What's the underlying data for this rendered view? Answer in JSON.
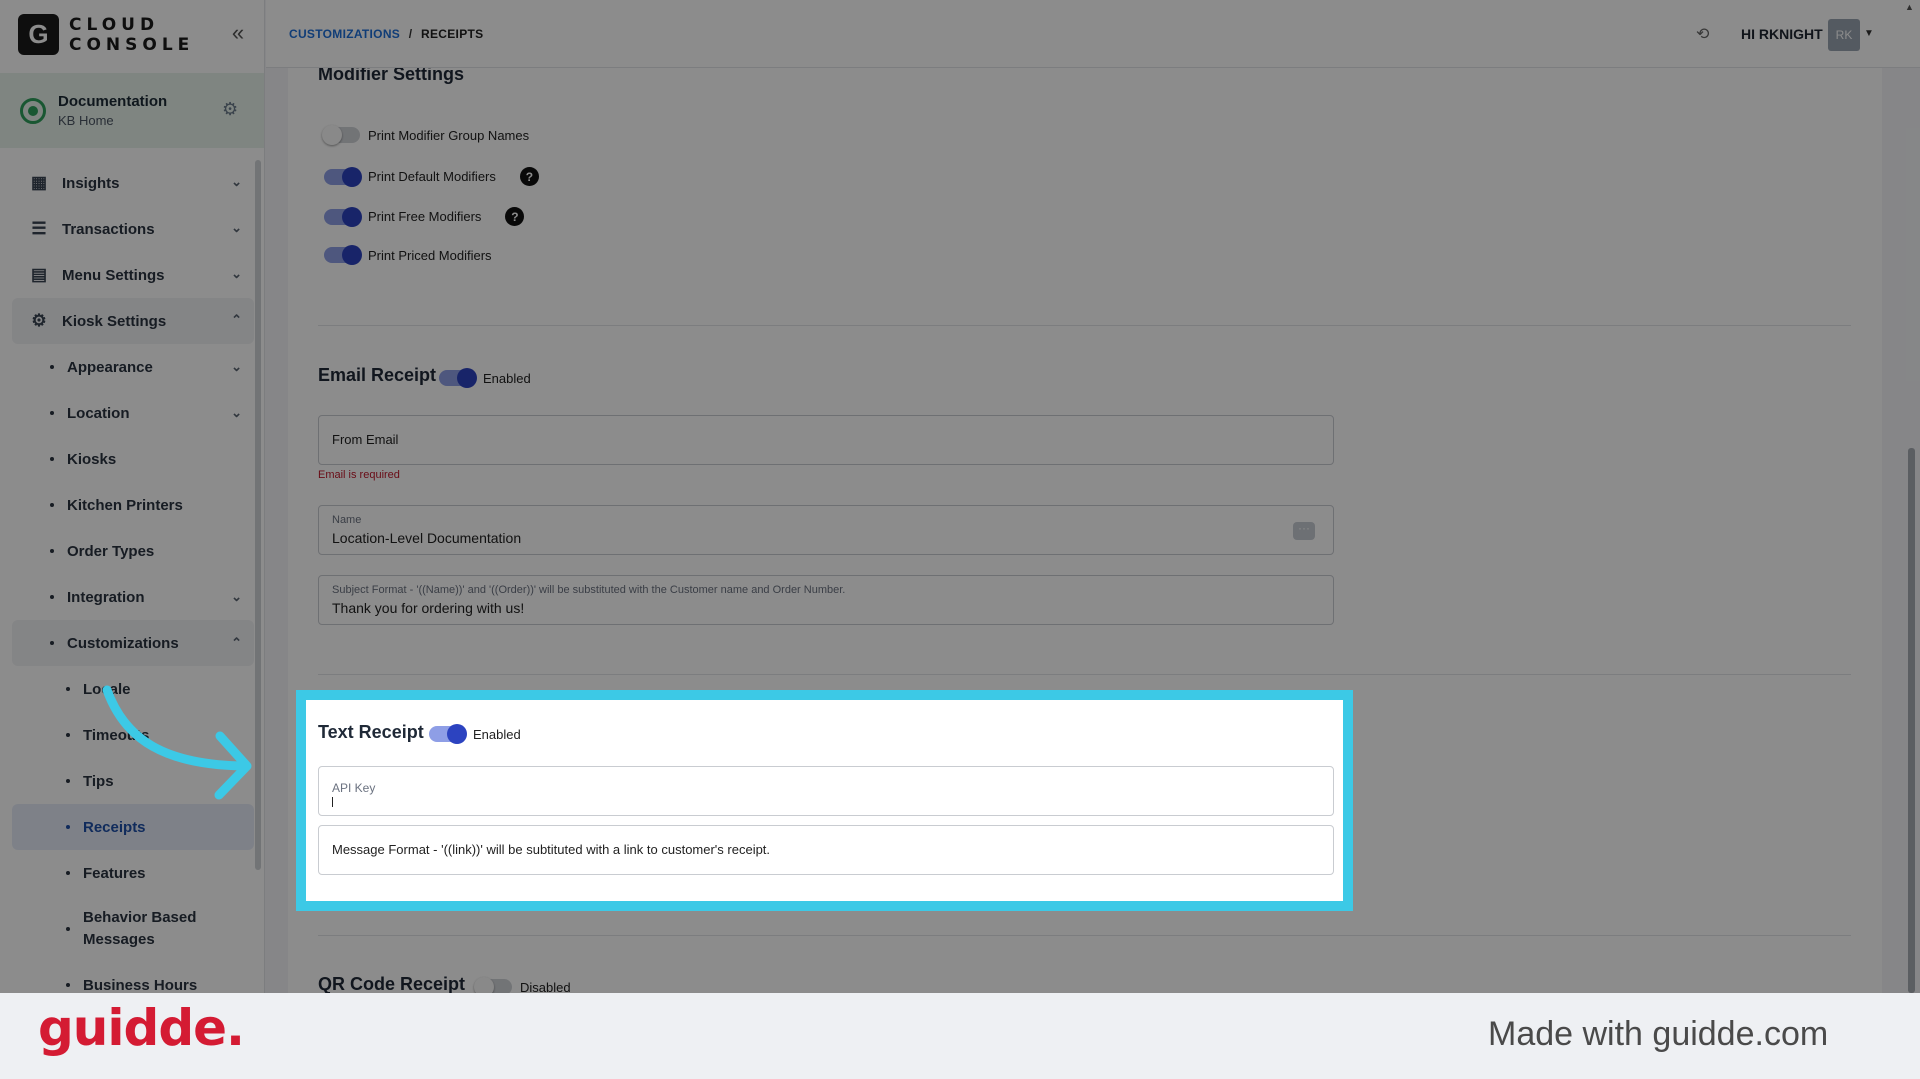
{
  "app": {
    "logo_letter": "G",
    "logo_line1": "CLOUD",
    "logo_line2": "CONSOLE"
  },
  "org": {
    "name": "Documentation",
    "sub": "KB Home"
  },
  "sidebar": {
    "items": [
      {
        "label": "Insights",
        "icon": "insights-icon"
      },
      {
        "label": "Transactions",
        "icon": "transactions-icon"
      },
      {
        "label": "Menu Settings",
        "icon": "menu-settings-icon"
      },
      {
        "label": "Kiosk Settings",
        "icon": "gear-icon"
      }
    ],
    "kiosk_sub": [
      "Appearance",
      "Location",
      "Kiosks",
      "Kitchen Printers",
      "Order Types",
      "Integration",
      "Customizations"
    ],
    "customizations_sub": [
      "Locale",
      "Timeouts",
      "Tips",
      "Receipts",
      "Features",
      "Behavior Based Messages",
      "Business Hours"
    ]
  },
  "topbar": {
    "breadcrumb_link": "CUSTOMIZATIONS",
    "breadcrumb_sep": "/",
    "breadcrumb_current": "RECEIPTS",
    "greeting": "HI RKNIGHT",
    "avatar_initials": "RK"
  },
  "modifier": {
    "title": "Modifier Settings",
    "toggles": [
      {
        "label": "Print Modifier Group Names",
        "on": false
      },
      {
        "label": "Print Default Modifiers",
        "on": true
      },
      {
        "label": "Print Free Modifiers",
        "on": true
      },
      {
        "label": "Print Priced Modifiers",
        "on": true
      }
    ],
    "help_glyph": "?"
  },
  "email": {
    "title": "Email Receipt",
    "status": "Enabled",
    "from_placeholder": "From Email",
    "error": "Email is required",
    "name_label": "Name",
    "name_value": "Location-Level Documentation",
    "subject_label": "Subject Format - '((Name))' and '((Order))' will be substituted with the Customer name and Order Number.",
    "subject_value": "Thank you for ordering with us!"
  },
  "text_receipt": {
    "title": "Text Receipt",
    "status": "Enabled",
    "api_key_label": "API Key",
    "message_placeholder": "Message Format - '((link))' will be subtituted with a link to customer's receipt."
  },
  "qr": {
    "title": "QR Code Receipt",
    "status": "Disabled"
  },
  "footer": {
    "brand": "guidde.",
    "made_with": "Made with guidde.com"
  },
  "colors": {
    "accent": "#2c43c0",
    "highlight": "#3cc9e6",
    "brand": "#d41b33",
    "error": "#c0182b"
  }
}
